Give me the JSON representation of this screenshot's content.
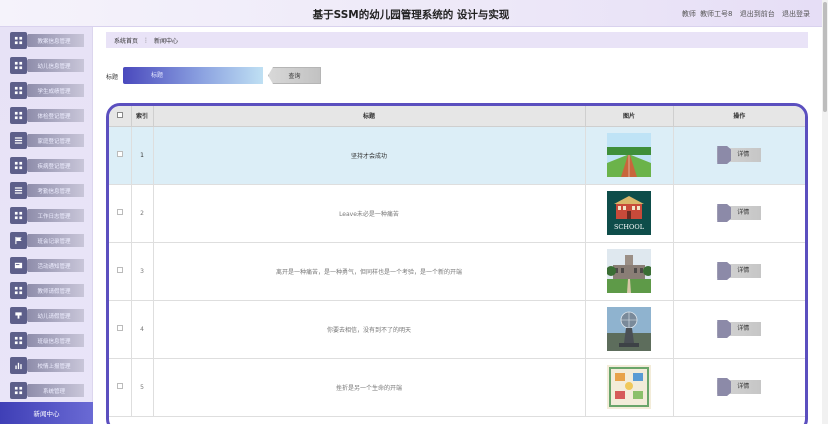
{
  "header": {
    "title": "基于SSM的幼儿园管理系统的 设计与实现",
    "user_role": "教师",
    "user_name": "教师工号8",
    "back_link": "退出到前台",
    "logout_link": "退出登录"
  },
  "sidebar": {
    "items": [
      {
        "label": "教案信息管理",
        "icon": "grid-icon"
      },
      {
        "label": "幼儿信息管理",
        "icon": "grid-icon"
      },
      {
        "label": "学生成绩管理",
        "icon": "grid-icon"
      },
      {
        "label": "体检登记管理",
        "icon": "grid-icon"
      },
      {
        "label": "家庭登记管理",
        "icon": "list-icon"
      },
      {
        "label": "疾病登记管理",
        "icon": "grid-icon"
      },
      {
        "label": "考勤信息管理",
        "icon": "list-icon"
      },
      {
        "label": "工作日志管理",
        "icon": "grid-icon"
      },
      {
        "label": "班会记录管理",
        "icon": "flag-icon"
      },
      {
        "label": "活动通知管理",
        "icon": "card-icon"
      },
      {
        "label": "教师请假管理",
        "icon": "grid-icon"
      },
      {
        "label": "幼儿请假管理",
        "icon": "cup-icon"
      },
      {
        "label": "班级信息管理",
        "icon": "grid-icon"
      },
      {
        "label": "校情上报管理",
        "icon": "chart-icon"
      },
      {
        "label": "系统管理",
        "icon": "grid-icon"
      }
    ],
    "active_item": "新闻中心"
  },
  "breadcrumb": {
    "home": "系统首页",
    "current": "新闻中心"
  },
  "search": {
    "label": "标题",
    "placeholder": "标题",
    "button": "查询"
  },
  "table": {
    "headers": [
      "",
      "索引",
      "标题",
      "图片",
      "操作"
    ],
    "rows": [
      {
        "index": "1",
        "title": "坚持才会成功",
        "image": "running-track-image",
        "action": "详情"
      },
      {
        "index": "2",
        "title": "Leave未必是一种痛苦",
        "image": "school-building-image",
        "action": "详情"
      },
      {
        "index": "3",
        "title": "离开是一种痛苦，是一种勇气，但同样也是一个考验，是一个新的开端",
        "image": "campus-tower-image",
        "action": "详情"
      },
      {
        "index": "4",
        "title": "你要去相信，没有到不了的明天",
        "image": "globe-statue-image",
        "action": "详情"
      },
      {
        "index": "5",
        "title": "挫折是另一个生命的开端",
        "image": "classroom-illustration-image",
        "action": "详情"
      }
    ],
    "school_sign_text": "SCHOOL"
  },
  "colors": {
    "accent": "#5b4fbf",
    "sidebar_active": "#3f3fb6",
    "highlight_row": "#dceef7"
  }
}
